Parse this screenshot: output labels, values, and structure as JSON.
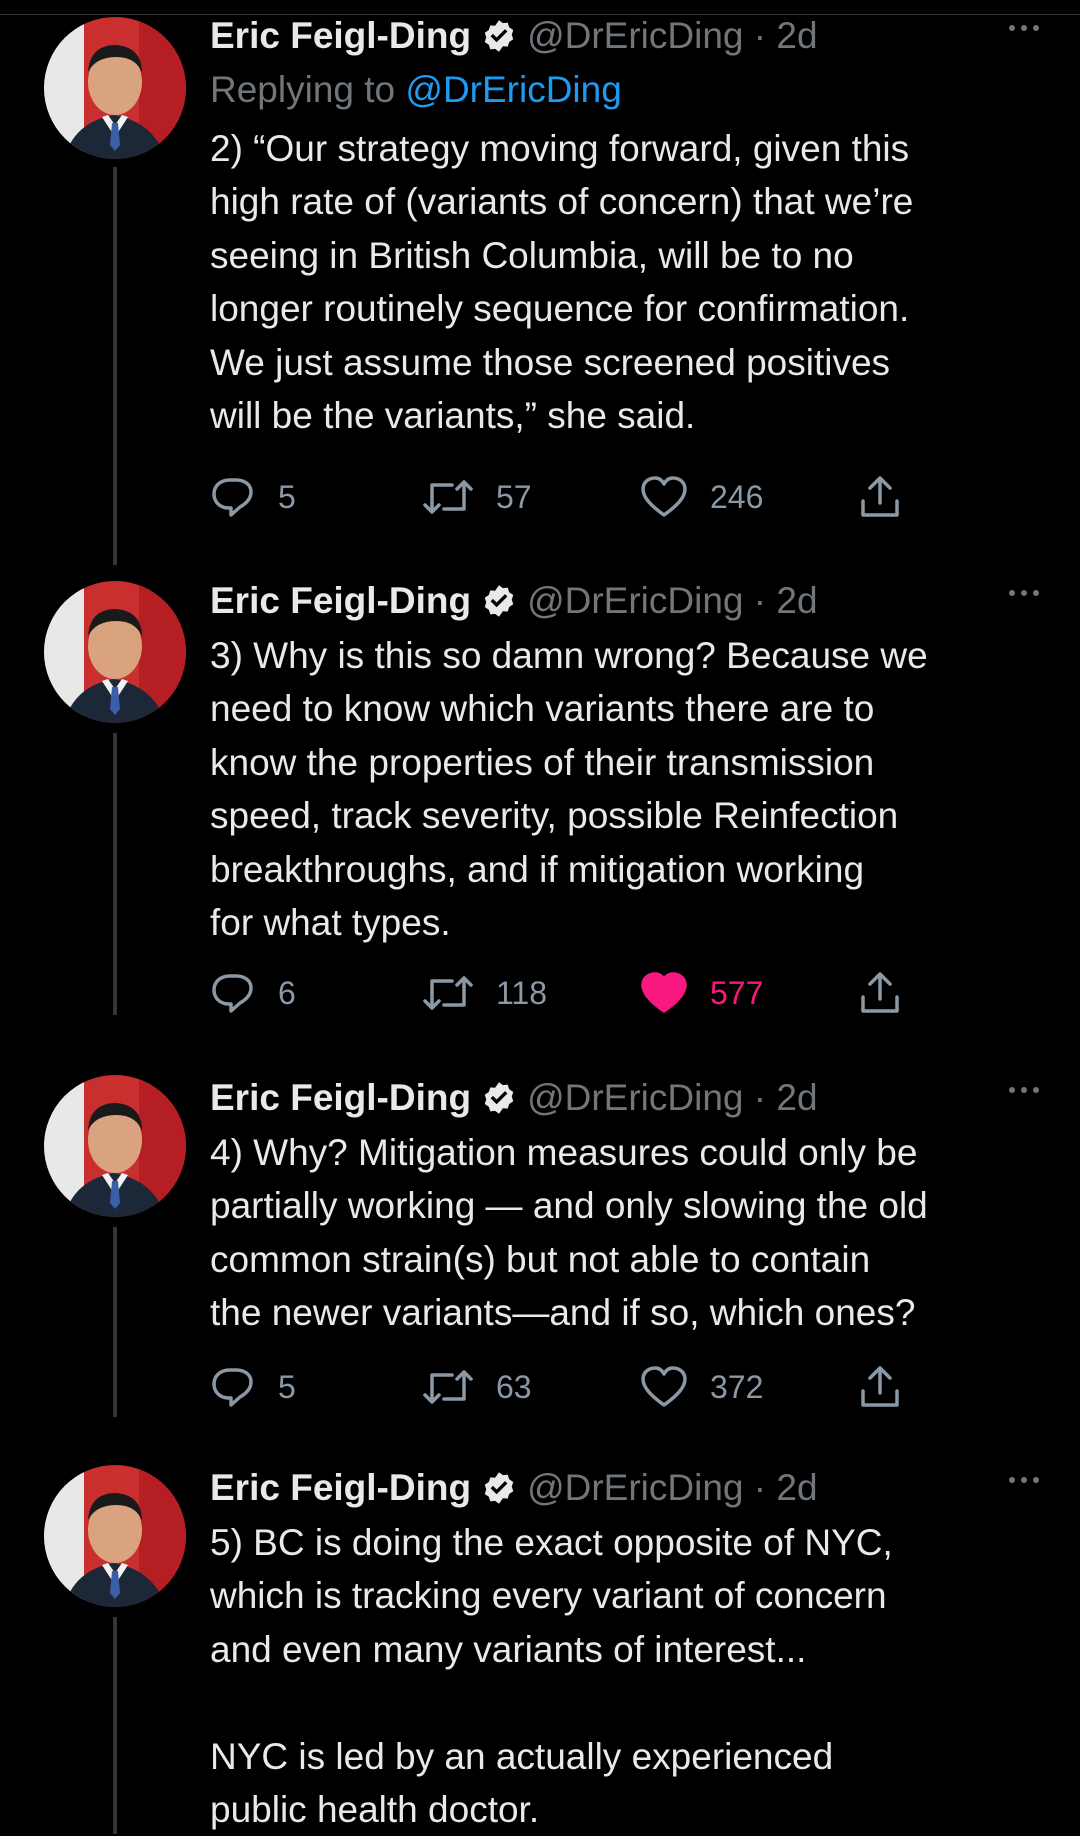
{
  "tweets": [
    {
      "author": "Eric Feigl-Ding",
      "handle": "@DrEricDing",
      "time": "2d",
      "replying_label": "Replying to",
      "replying_to": "@DrEricDing",
      "text": "2) “Our strategy moving forward, given this\nhigh rate of (variants of concern) that we’re\nseeing in British Columbia, will be to no\nlonger routinely sequence for confirmation.\nWe just assume those screened positives\nwill be the variants,” she said.",
      "replies": "5",
      "retweets": "57",
      "likes": "246",
      "liked": false
    },
    {
      "author": "Eric Feigl-Ding",
      "handle": "@DrEricDing",
      "time": "2d",
      "text": "3) Why is this so damn wrong? Because we\nneed to know which variants there are to\nknow the properties of their transmission\nspeed, track severity, possible Reinfection\nbreakthroughs, and if mitigation working\nfor what types.",
      "replies": "6",
      "retweets": "118",
      "likes": "577",
      "liked": true
    },
    {
      "author": "Eric Feigl-Ding",
      "handle": "@DrEricDing",
      "time": "2d",
      "text": "4) Why? Mitigation measures could only be\npartially working — and only slowing the old\ncommon strain(s) but not able to contain\nthe newer variants—and if so, which ones?",
      "replies": "5",
      "retweets": "63",
      "likes": "372",
      "liked": false
    },
    {
      "author": "Eric Feigl-Ding",
      "handle": "@DrEricDing",
      "time": "2d",
      "text": "5) BC is doing the exact opposite of NYC,\nwhich is tracking every variant of concern\nand even many variants of interest...\n\nNYC is led by an actually experienced\npublic health doctor."
    }
  ],
  "icons": {
    "reply": "reply-icon",
    "retweet": "retweet-icon",
    "like": "heart-icon",
    "share": "share-icon",
    "verified": "verified-badge-icon",
    "more": "more-options-icon"
  },
  "colors": {
    "background": "#000000",
    "text": "#e7e9ea",
    "secondary": "#71767b",
    "link": "#1d9bf0",
    "like_active": "#f91880"
  }
}
